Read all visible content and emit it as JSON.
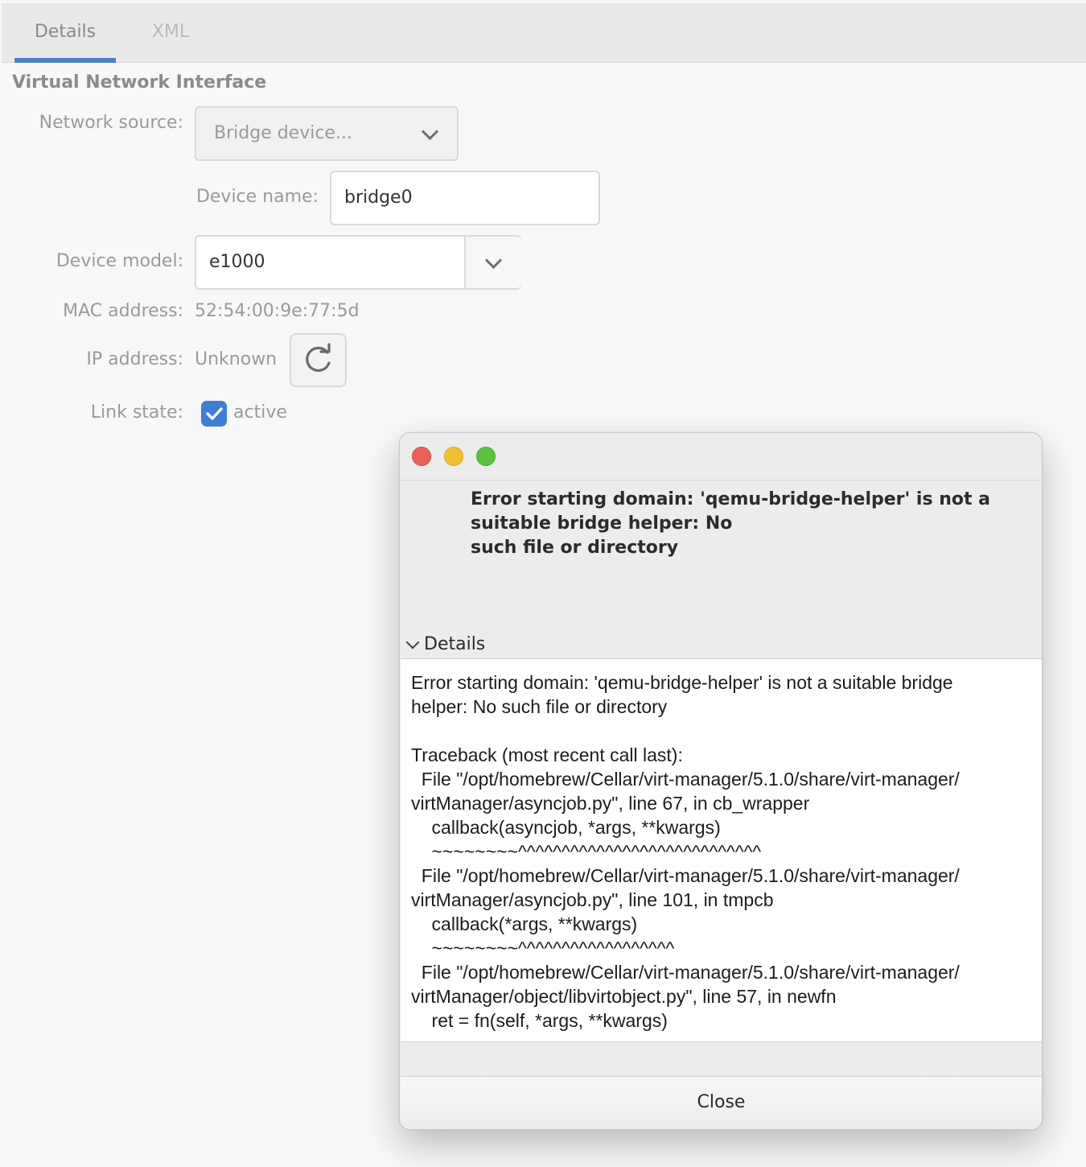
{
  "tabs": [
    {
      "label": "Details",
      "active": true
    },
    {
      "label": "XML",
      "active": false
    }
  ],
  "section_title": "Virtual Network Interface",
  "form": {
    "network_source": {
      "label": "Network source:",
      "value": "Bridge device..."
    },
    "device_name": {
      "label": "Device name:",
      "value": "bridge0"
    },
    "device_model": {
      "label": "Device model:",
      "value": "e1000"
    },
    "mac_address": {
      "label": "MAC address:",
      "value": "52:54:00:9e:77:5d"
    },
    "ip_address": {
      "label": "IP address:",
      "value": "Unknown"
    },
    "link_state": {
      "label": "Link state:",
      "value": "active",
      "checked": true
    }
  },
  "dialog": {
    "message_lines": [
      "Error starting domain: 'qemu-bridge-helper' is not a",
      "suitable bridge helper: No",
      "such file or directory"
    ],
    "details_label": "Details",
    "details_lines": [
      "Error starting domain: 'qemu-bridge-helper' is not a suitable bridge",
      "helper: No such file or directory",
      "",
      "Traceback (most recent call last):",
      "  File \"/opt/homebrew/Cellar/virt-manager/5.1.0/share/virt-manager/",
      "virtManager/asyncjob.py\", line 67, in cb_wrapper",
      "    callback(asyncjob, *args, **kwargs)",
      "    ~~~~~~~~^^^^^^^^^^^^^^^^^^^^^^^^^^^^",
      "  File \"/opt/homebrew/Cellar/virt-manager/5.1.0/share/virt-manager/",
      "virtManager/asyncjob.py\", line 101, in tmpcb",
      "    callback(*args, **kwargs)",
      "    ~~~~~~~~^^^^^^^^^^^^^^^^^^",
      "  File \"/opt/homebrew/Cellar/virt-manager/5.1.0/share/virt-manager/",
      "virtManager/object/libvirtobject.py\", line 57, in newfn",
      "    ret = fn(self, *args, **kwargs)"
    ],
    "close_label": "Close"
  },
  "colors": {
    "accent": "#4a7fd1",
    "close": "#ec5f57",
    "minimize": "#f3bf2f",
    "zoom": "#58c23a"
  },
  "icons": [
    "chevron-down-icon",
    "refresh-icon",
    "checkmark-icon"
  ]
}
